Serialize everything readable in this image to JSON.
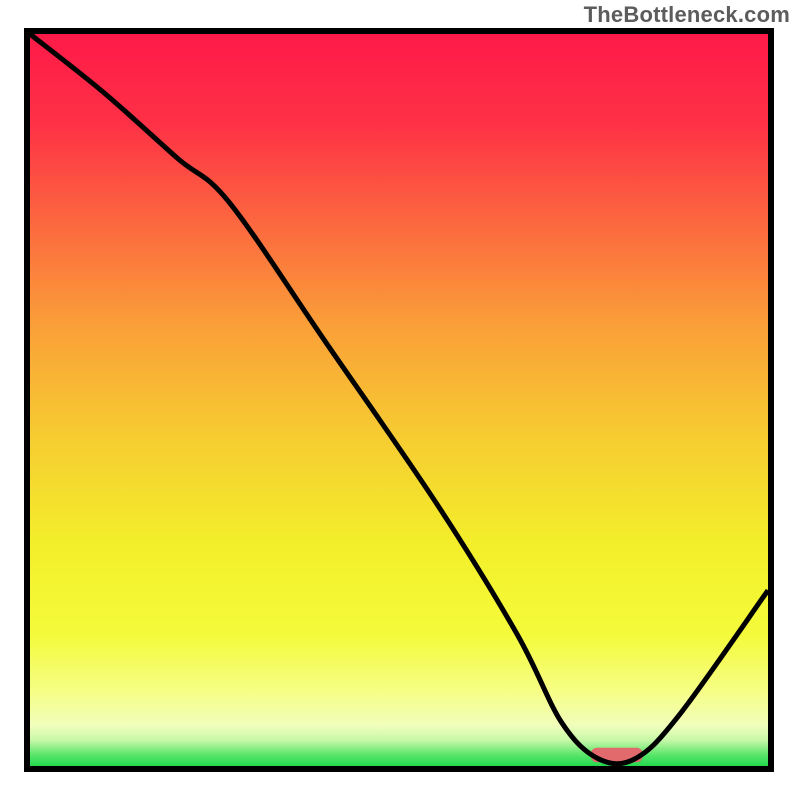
{
  "watermark": "TheBottleneck.com",
  "colors": {
    "frame": "#000000",
    "curve": "#000000",
    "marker": "#e26a6d"
  },
  "gradient_stops": [
    {
      "offset": 0.0,
      "color": "#fe1a48"
    },
    {
      "offset": 0.12,
      "color": "#fe3046"
    },
    {
      "offset": 0.25,
      "color": "#fc6440"
    },
    {
      "offset": 0.4,
      "color": "#faa038"
    },
    {
      "offset": 0.55,
      "color": "#f6cc31"
    },
    {
      "offset": 0.7,
      "color": "#f3ef2a"
    },
    {
      "offset": 0.82,
      "color": "#f4fb3a"
    },
    {
      "offset": 0.9,
      "color": "#f6fe88"
    },
    {
      "offset": 0.945,
      "color": "#f0febb"
    },
    {
      "offset": 0.965,
      "color": "#c6f8a7"
    },
    {
      "offset": 0.985,
      "color": "#58e56a"
    },
    {
      "offset": 1.0,
      "color": "#23da4e"
    }
  ],
  "chart_data": {
    "type": "line",
    "title": "",
    "xlabel": "",
    "ylabel": "",
    "xlim": [
      0,
      100
    ],
    "ylim": [
      0,
      100
    ],
    "x": [
      0,
      10,
      20,
      27,
      40,
      55,
      66,
      72,
      77,
      82,
      88,
      100
    ],
    "values": [
      100,
      92,
      83,
      77,
      58,
      36,
      18,
      6,
      1,
      1,
      7,
      24
    ],
    "marker": {
      "x_start": 76,
      "x_end": 83,
      "y": 1.5,
      "thickness": 2.0
    }
  }
}
